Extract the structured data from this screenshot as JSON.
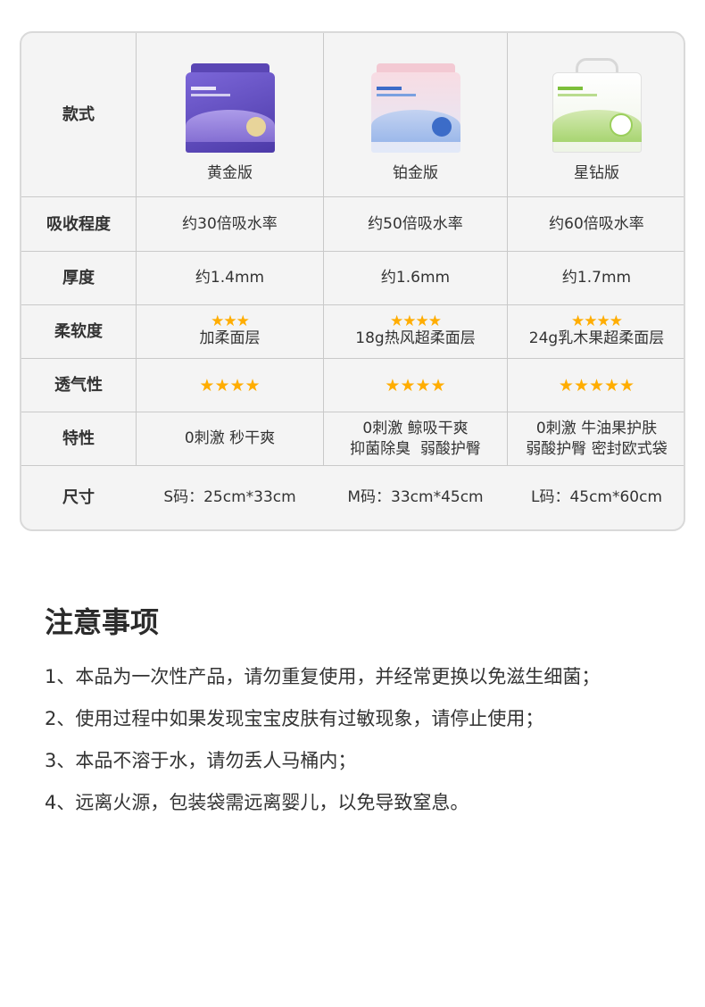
{
  "table": {
    "columns": [
      "黄金版",
      "铂金版",
      "星钻版"
    ],
    "rows": {
      "style_label": "款式",
      "absorb_label": "吸收程度",
      "absorb": [
        "约30倍吸水率",
        "约50倍吸水率",
        "约60倍吸水率"
      ],
      "thickness_label": "厚度",
      "thickness": [
        "约1.4mm",
        "约1.6mm",
        "约1.7mm"
      ],
      "softness_label": "柔软度",
      "softness_stars": [
        "★★★",
        "★★★★",
        "★★★★"
      ],
      "softness_rating": [
        3,
        4,
        4
      ],
      "softness": [
        "加柔面层",
        "18g热风超柔面层",
        "24g乳木果超柔面层"
      ],
      "breath_label": "透气性",
      "breath_stars": [
        "★★★★",
        "★★★★",
        "★★★★★"
      ],
      "breath_rating": [
        4,
        4,
        5
      ],
      "feature_label": "特性",
      "feature_line1": [
        "0刺激 秒干爽",
        "0刺激 鲸吸干爽",
        "0刺激 牛油果护肤"
      ],
      "feature_line2": [
        "",
        "抑菌除臭  弱酸护臀",
        "弱酸护臀 密封欧式袋"
      ],
      "size_label": "尺寸",
      "size": [
        "S码：25cm*33cm",
        "M码：33cm*45cm",
        "L码：45cm*60cm"
      ]
    },
    "colors": {
      "gold_pack": "#6b55c8",
      "platinum_pack": "#dfe6f5",
      "diamond_pack": "#f2f7ec",
      "star": "#ffad00"
    }
  },
  "notes": {
    "title": "注意事项",
    "items": [
      "1、本品为一次性产品，请勿重复使用，并经常更换以免滋生细菌；",
      "2、使用过程中如果发现宝宝皮肤有过敏现象，请停止使用；",
      "3、本品不溶于水，请勿丢人马桶内；",
      "4、远离火源，包装袋需远离婴儿，以免导致窒息。"
    ]
  }
}
